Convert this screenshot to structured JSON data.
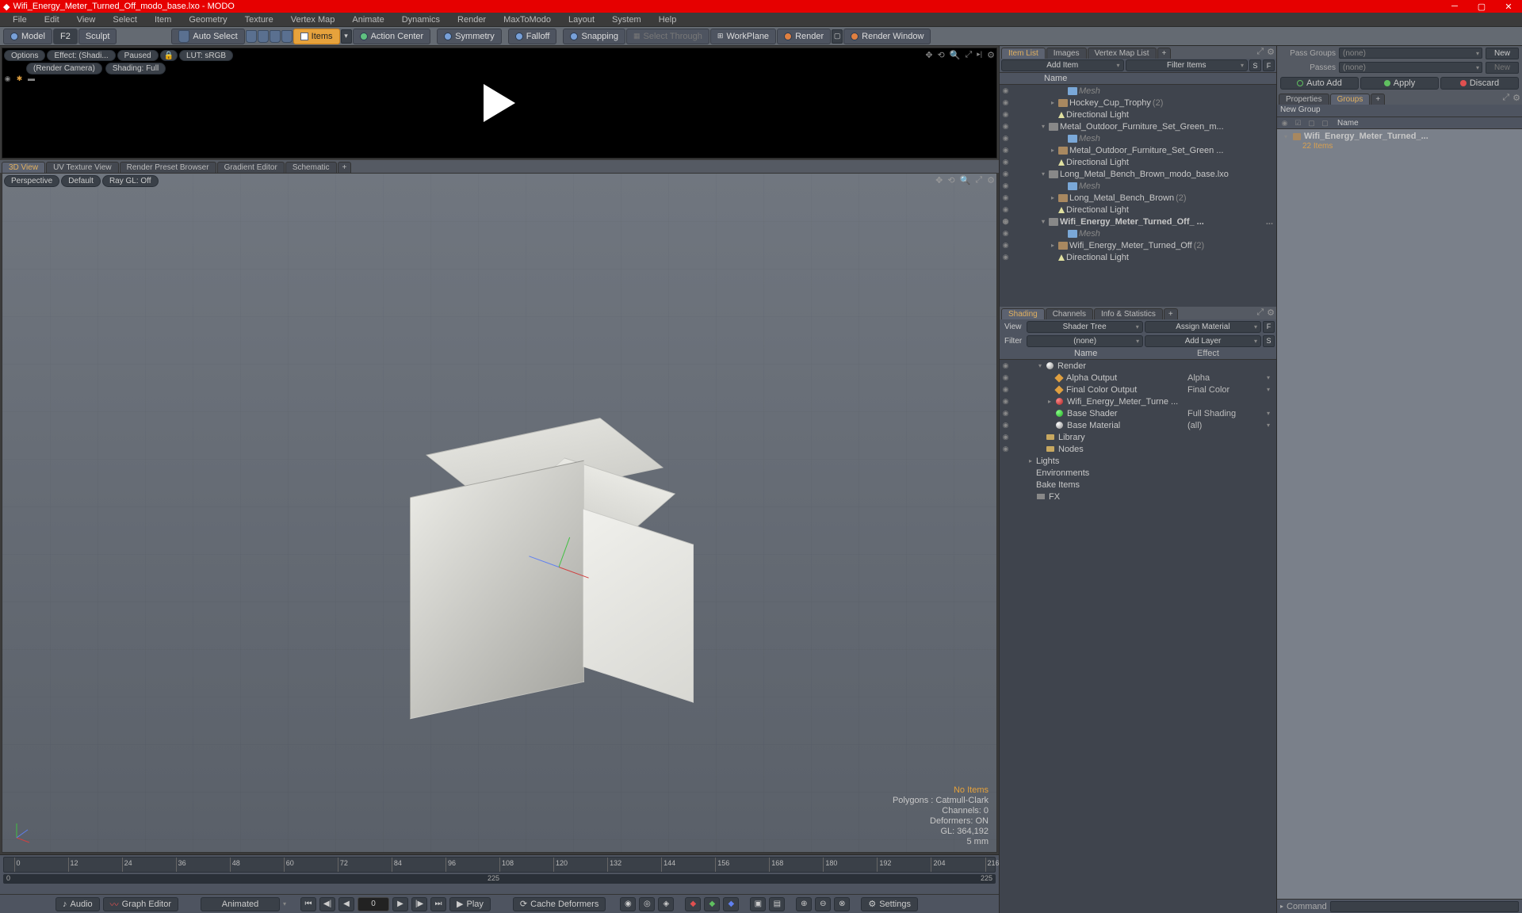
{
  "title": "Wifi_Energy_Meter_Turned_Off_modo_base.lxo - MODO",
  "menu": [
    "File",
    "Edit",
    "View",
    "Select",
    "Item",
    "Geometry",
    "Texture",
    "Vertex Map",
    "Animate",
    "Dynamics",
    "Render",
    "MaxToModo",
    "Layout",
    "System",
    "Help"
  ],
  "toolbar": {
    "model": "Model",
    "f2": "F2",
    "sculpt": "Sculpt",
    "auto_select": "Auto Select",
    "items": "Items",
    "action_center": "Action Center",
    "symmetry": "Symmetry",
    "falloff": "Falloff",
    "snapping": "Snapping",
    "select_through": "Select Through",
    "workplane": "WorkPlane",
    "render": "Render",
    "render_window": "Render Window"
  },
  "preview": {
    "options": "Options",
    "effect": "Effect: (Shadi...",
    "paused": "Paused",
    "lut": "LUT: sRGB",
    "camera": "(Render Camera)",
    "shading": "Shading: Full"
  },
  "vtabs": [
    "3D View",
    "UV Texture View",
    "Render Preset Browser",
    "Gradient Editor",
    "Schematic"
  ],
  "vp": {
    "perspective": "Perspective",
    "default": "Default",
    "raygl": "Ray GL: Off"
  },
  "vp_info": {
    "no_items": "No Items",
    "polygons": "Polygons : Catmull-Clark",
    "channels": "Channels: 0",
    "deformers": "Deformers: ON",
    "gl": "GL: 364,192",
    "units": "5 mm"
  },
  "timeline": {
    "ticks": [
      "0",
      "12",
      "24",
      "36",
      "48",
      "60",
      "72",
      "84",
      "96",
      "108",
      "120",
      "132",
      "144",
      "156",
      "168",
      "180",
      "192",
      "204",
      "216"
    ],
    "start": "0",
    "end": "225"
  },
  "bottom": {
    "audio": "Audio",
    "graph": "Graph Editor",
    "animated": "Animated",
    "frame": "0",
    "play": "Play",
    "cache": "Cache Deformers",
    "settings": "Settings"
  },
  "item_tabs": [
    "Item List",
    "Images",
    "Vertex Map List"
  ],
  "item_bar": {
    "add": "Add Item",
    "filter": "Filter Items",
    "s": "S",
    "f": "F"
  },
  "item_header": "Name",
  "items": [
    {
      "d": 3,
      "icon": "mesh",
      "label": "Mesh",
      "dim": true
    },
    {
      "d": 2,
      "t": "▸",
      "icon": "group",
      "label": "Hockey_Cup_Trophy",
      "count": "(2)"
    },
    {
      "d": 2,
      "icon": "light",
      "label": "Directional Light"
    },
    {
      "d": 1,
      "t": "▾",
      "icon": "scene",
      "label": "Metal_Outdoor_Furniture_Set_Green_m..."
    },
    {
      "d": 3,
      "icon": "mesh",
      "label": "Mesh",
      "dim": true
    },
    {
      "d": 2,
      "t": "▸",
      "icon": "group",
      "label": "Metal_Outdoor_Furniture_Set_Green ..."
    },
    {
      "d": 2,
      "icon": "light",
      "label": "Directional Light"
    },
    {
      "d": 1,
      "t": "▾",
      "icon": "scene",
      "label": "Long_Metal_Bench_Brown_modo_base.lxo"
    },
    {
      "d": 3,
      "icon": "mesh",
      "label": "Mesh",
      "dim": true
    },
    {
      "d": 2,
      "t": "▸",
      "icon": "group",
      "label": "Long_Metal_Bench_Brown",
      "count": "(2)"
    },
    {
      "d": 2,
      "icon": "light",
      "label": "Directional Light"
    },
    {
      "d": 1,
      "t": "▾",
      "icon": "scene",
      "label": "Wifi_Energy_Meter_Turned_Off_ ...",
      "bold": true,
      "ell": "..."
    },
    {
      "d": 3,
      "icon": "mesh",
      "label": "Mesh",
      "dim": true
    },
    {
      "d": 2,
      "t": "▸",
      "icon": "group",
      "label": "Wifi_Energy_Meter_Turned_Off",
      "count": "(2)"
    },
    {
      "d": 2,
      "icon": "light",
      "label": "Directional Light"
    }
  ],
  "shading_tabs": [
    "Shading",
    "Channels",
    "Info & Statistics"
  ],
  "shading_bar": {
    "view": "View",
    "shader_tree": "Shader Tree",
    "assign": "Assign Material",
    "f": "F",
    "filter": "Filter",
    "none": "(none)",
    "add_layer": "Add Layer",
    "s": "S"
  },
  "sh_header": {
    "name": "Name",
    "effect": "Effect"
  },
  "shaders": [
    {
      "d": 1,
      "t": "▾",
      "icon": "ball",
      "label": "Render"
    },
    {
      "d": 2,
      "icon": "diamond",
      "label": "Alpha Output",
      "effect": "Alpha"
    },
    {
      "d": 2,
      "icon": "diamond",
      "label": "Final Color Output",
      "effect": "Final Color"
    },
    {
      "d": 2,
      "t": "▸",
      "icon": "ball-red",
      "label": "Wifi_Energy_Meter_Turne ..."
    },
    {
      "d": 2,
      "icon": "ball-grn",
      "label": "Base Shader",
      "effect": "Full Shading"
    },
    {
      "d": 2,
      "icon": "ball",
      "label": "Base Material",
      "effect": "(all)"
    },
    {
      "d": 1,
      "icon": "folder",
      "label": "Library"
    },
    {
      "d": 1,
      "icon": "folder",
      "label": "Nodes"
    },
    {
      "d": 0,
      "t": "▸",
      "label": "Lights"
    },
    {
      "d": 0,
      "label": "Environments"
    },
    {
      "d": 0,
      "label": "Bake Items"
    },
    {
      "d": 0,
      "icon": "camera",
      "label": "FX"
    }
  ],
  "passes": {
    "pass_groups": "Pass Groups",
    "passes": "Passes",
    "none": "(none)",
    "new": "New",
    "auto_add": "Auto Add",
    "apply": "Apply",
    "discard": "Discard"
  },
  "pg_tabs": [
    "Properties",
    "Groups"
  ],
  "pg_header": "Name",
  "new_group": "New Group",
  "group_item": "Wifi_Energy_Meter_Turned_...",
  "group_count": "22 Items",
  "status": {
    "command": "Command"
  }
}
